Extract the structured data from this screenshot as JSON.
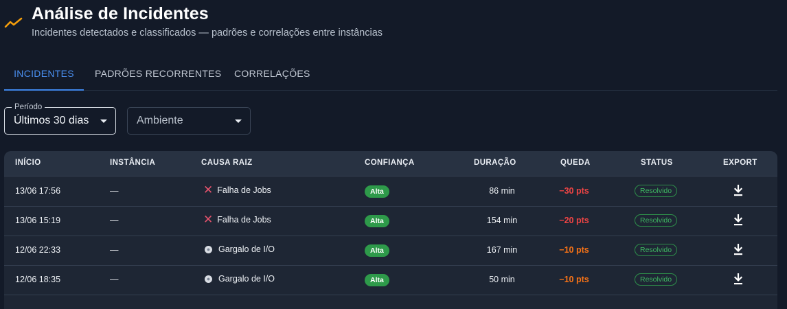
{
  "header": {
    "title": "Análise de Incidentes",
    "subtitle": "Incidentes detectados e classificados — padrões e correlações entre instâncias",
    "icon": "trend-line-icon",
    "icon_color": "#f59e0b"
  },
  "tabs": [
    {
      "label": "INCIDENTES",
      "active": true
    },
    {
      "label": "PADRÕES RECORRENTES",
      "active": false
    },
    {
      "label": "CORRELAÇÕES",
      "active": false
    }
  ],
  "filters": {
    "period": {
      "legend": "Período",
      "value": "Últimos 30 dias"
    },
    "environment": {
      "placeholder": "Ambiente"
    }
  },
  "table": {
    "columns": [
      "INÍCIO",
      "INSTÂNCIA",
      "CAUSA RAIZ",
      "CONFIANÇA",
      "DURAÇÃO",
      "QUEDA",
      "STATUS",
      "EXPORT"
    ],
    "rows": [
      {
        "start": "13/06 17:56",
        "instance": "—",
        "cause": "Falha de Jobs",
        "cause_icon": "x-icon",
        "confidence": "Alta",
        "duration": "86 min",
        "drop": "−30 pts",
        "status": "Resolvido"
      },
      {
        "start": "13/06 15:19",
        "instance": "—",
        "cause": "Falha de Jobs",
        "cause_icon": "x-icon",
        "confidence": "Alta",
        "duration": "154 min",
        "drop": "−20 pts",
        "status": "Resolvido"
      },
      {
        "start": "12/06 22:33",
        "instance": "—",
        "cause": "Gargalo de I/O",
        "cause_icon": "disk-icon",
        "confidence": "Alta",
        "duration": "167 min",
        "drop": "−10 pts",
        "status": "Resolvido"
      },
      {
        "start": "12/06 18:35",
        "instance": "—",
        "cause": "Gargalo de I/O",
        "cause_icon": "disk-icon",
        "confidence": "Alta",
        "duration": "50 min",
        "drop": "−10 pts",
        "status": "Resolvido"
      }
    ]
  },
  "colors": {
    "background": "#131a28",
    "accent": "#3f86ea",
    "drop_high": "#ef4444",
    "drop_medium": "#f97316",
    "confidence_high": "#2e9a4a",
    "status_resolved": "#3fb862"
  }
}
